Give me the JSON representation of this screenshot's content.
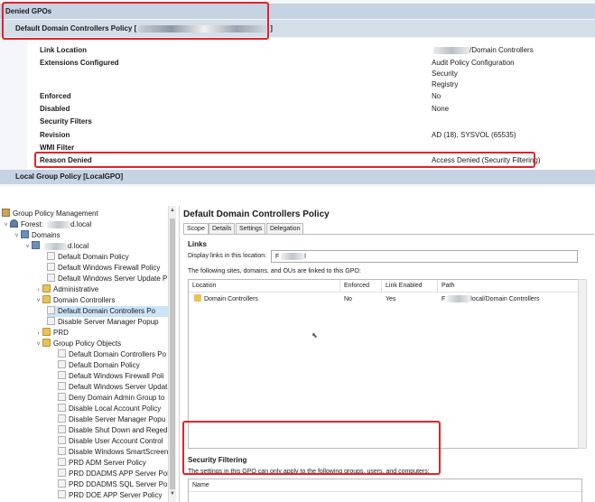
{
  "report": {
    "denied_header": "Denied GPOs",
    "gpo_header": "Default Domain Controllers Policy [",
    "gpo_header_suffix": "]",
    "rows": [
      {
        "label": "Link Location",
        "value": "/Domain Controllers"
      },
      {
        "label": "Extensions Configured",
        "values": [
          "Audit Policy Configuration",
          "Security",
          "Registry"
        ]
      },
      {
        "label": "Enforced",
        "value": "No"
      },
      {
        "label": "Disabled",
        "value": "None"
      },
      {
        "label": "Security Filters",
        "value": ""
      },
      {
        "label": "Revision",
        "value": "AD (18), SYSVOL (65535)"
      },
      {
        "label": "WMI Filter",
        "value": ""
      },
      {
        "label": "Reason Denied",
        "value": "Access Denied (Security Filtering)"
      }
    ],
    "local_header": "Local Group Policy [LocalGPO]"
  },
  "tree": {
    "root": "Group Policy Management",
    "forest": "Forest:",
    "forest_suffix": "d.local",
    "domains": "Domains",
    "domain": "d.local",
    "items": [
      "Default Domain Policy",
      "Default Windows Firewall Policy",
      "Default Windows Server Update P",
      "Administrative",
      "Domain Controllers",
      "Default Domain Controllers Po",
      "Disable Server Manager Popup",
      "PRD",
      "Group Policy Objects",
      "Default Domain Controllers Po",
      "Default Domain Policy",
      "Default Windows Firewall Poli",
      "Default Windows Server Updat",
      "Deny Domain Admin Group to",
      "Disable Local Account Policy",
      "Disable Server Manager Popu",
      "Disable Shut Down and Reged",
      "Disable User Account Control",
      "Disable Windows SmartScreen",
      "PRD ADM Server Policy",
      "PRD DDADMS APP Server Poli",
      "PRD DDADMS SQL Server Poli",
      "PRD DOE APP Server Policy"
    ]
  },
  "details": {
    "title": "Default Domain Controllers Policy",
    "tabs": [
      "Scope",
      "Details",
      "Settings",
      "Delegation"
    ],
    "links_header": "Links",
    "display_links_label": "Display links in this location:",
    "display_links_value": "F",
    "display_links_suffix": "l",
    "following_text": "The following sites, domains, and OUs are linked to this GPO:",
    "columns": [
      "Location",
      "Enforced",
      "Link Enabled",
      "Path"
    ],
    "rows": [
      {
        "location": "Domain Controllers",
        "enforced": "No",
        "link_enabled": "Yes",
        "path_prefix": "F",
        "path_suffix": "local/Domain Controllers"
      }
    ],
    "security_filtering_header": "Security Filtering",
    "security_filtering_desc": "The settings in this GPO can only apply to the following groups, users, and computers:",
    "security_filtering_column": "Name"
  }
}
